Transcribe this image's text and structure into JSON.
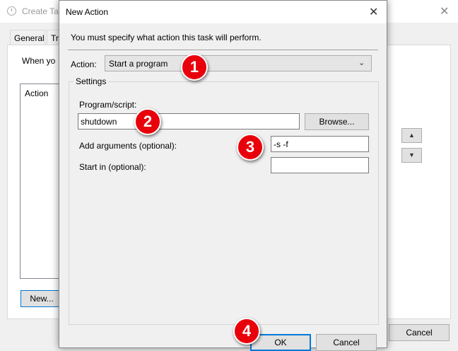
{
  "background_window": {
    "title": "Create Tas",
    "tabs": [
      "General",
      "Tr"
    ],
    "when_text": "When yo",
    "list_header": "Action",
    "new_button": "New...",
    "up_arrow": "▲",
    "down_arrow": "▼",
    "cancel_button": "Cancel",
    "close_glyph": "✕"
  },
  "dialog": {
    "title": "New Action",
    "close_glyph": "✕",
    "instruction": "You must specify what action this task will perform.",
    "action_label": "Action:",
    "action_value": "Start a program",
    "action_chevron": "⌄",
    "settings_legend": "Settings",
    "program_label": "Program/script:",
    "program_value": "shutdown",
    "browse_button": "Browse...",
    "arguments_label": "Add arguments (optional):",
    "arguments_value": "-s -f",
    "start_in_label": "Start in (optional):",
    "start_in_value": "",
    "ok_button": "OK",
    "cancel_button": "Cancel"
  },
  "markers": [
    "1",
    "2",
    "3",
    "4"
  ],
  "colors": {
    "marker": "#e8000b",
    "focus_border": "#0078d7"
  }
}
